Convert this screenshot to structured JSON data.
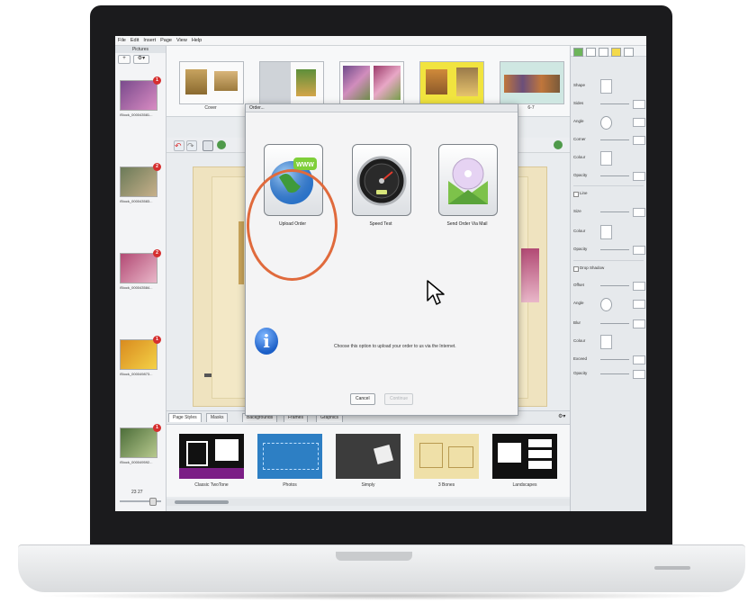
{
  "menu": [
    "File",
    "Edit",
    "Insert",
    "Page",
    "View",
    "Help"
  ],
  "left_panel": {
    "header": "Pictures",
    "add_label": "+",
    "tools_label": "⚙▾",
    "thumbnails": [
      {
        "caption": "iStock_000043581...",
        "badge": "1",
        "colors": [
          "#7a4a8c",
          "#d98cc3"
        ]
      },
      {
        "caption": "iStock_000043583...",
        "badge": "2",
        "colors": [
          "#6b7a58",
          "#c7b08a"
        ]
      },
      {
        "caption": "iStock_000043584...",
        "badge": "2",
        "colors": [
          "#b24a74",
          "#e9b7c9"
        ]
      },
      {
        "caption": "iStock_000049873...",
        "badge": "1",
        "colors": [
          "#d98b1f",
          "#f4d146"
        ]
      },
      {
        "caption": "iStock_000049592...",
        "badge": "1",
        "colors": [
          "#4d6e3a",
          "#b7c98e"
        ]
      }
    ],
    "count": "23 27"
  },
  "spreads": [
    {
      "caption": "Cover"
    },
    {
      "caption": "1"
    },
    {
      "caption": "2-3"
    },
    {
      "caption": "4-5"
    },
    {
      "caption": "6-7"
    }
  ],
  "dialog": {
    "title": "Order...",
    "options": [
      {
        "label": "Upload Order",
        "icon": "globe-www-icon"
      },
      {
        "label": "Speed Test",
        "icon": "speedometer-icon"
      },
      {
        "label": "Send Order Via Mail",
        "icon": "envelope-disc-icon"
      }
    ],
    "info_text": "Choose this option to upload your order to us via the Internet.",
    "cancel_label": "Cancel",
    "continue_label": "Continue"
  },
  "bottom_tabs": [
    "Page Styles",
    "Masks",
    "Backgrounds",
    "Frames",
    "Graphics"
  ],
  "page_styles": [
    {
      "label": "Classic TwoTone"
    },
    {
      "label": "Photos"
    },
    {
      "label": "Simply"
    },
    {
      "label": "3 Bones"
    },
    {
      "label": "Landscapes"
    }
  ],
  "right_panel": {
    "shape": "Shape",
    "sides": "Sides",
    "angle": "Angle",
    "corner": "Corner",
    "colour": "Colour",
    "opacity": "Opacity",
    "line": "Line",
    "size": "Size",
    "line_colour": "Colour",
    "line_opacity": "Opacity",
    "drop_shadow": "Drop Shadow",
    "offset": "Offset",
    "shadow_angle": "Angle",
    "blur": "Blur",
    "shadow_colour": "Colour",
    "exceed": "Exceed",
    "shadow_opacity": "Opacity"
  },
  "colors": {
    "highlight_ring": "#e06a3c",
    "accent_blue": "#1c5fc7"
  }
}
